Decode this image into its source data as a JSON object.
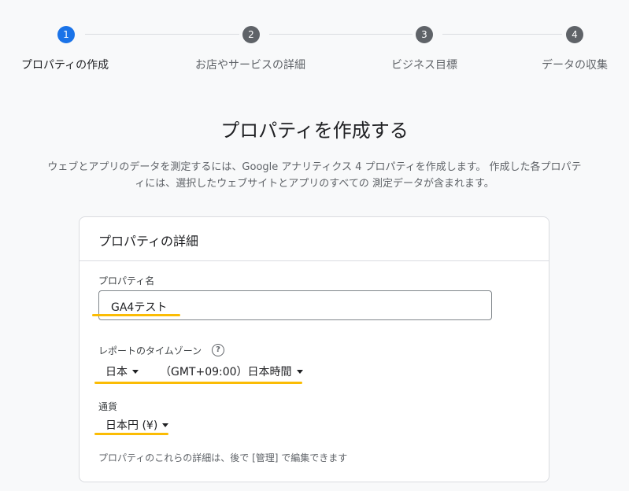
{
  "stepper": {
    "steps": [
      {
        "number": "1",
        "label": "プロパティの作成"
      },
      {
        "number": "2",
        "label": "お店やサービスの詳細"
      },
      {
        "number": "3",
        "label": "ビジネス目標"
      },
      {
        "number": "4",
        "label": "データの収集"
      }
    ],
    "active_step": 1,
    "active_color": "#1a73e8",
    "inactive_color": "#5f6368"
  },
  "page": {
    "title": "プロパティを作成する",
    "description_line1": "ウェブとアプリのデータを測定するには、Google アナリティクス 4 プロパティを作成します。 作成した各プロパテ",
    "description_line2": "ィには、選択したウェブサイトとアプリのすべての 測定データが含まれます。"
  },
  "card": {
    "header": "プロパティの詳細",
    "property_name_label": "プロパティ名",
    "property_name_value": "GA4テスト",
    "timezone_label": "レポートのタイムゾーン",
    "timezone_help_icon": "help-circle-icon",
    "country_value": "日本",
    "timezone_value": "（GMT+09:00）日本時間",
    "currency_label": "通貨",
    "currency_value": "日本円 (¥)",
    "note": "プロパティのこれらの詳細は、後で [管理] で編集できます",
    "highlight_color": "#fbbc04"
  }
}
